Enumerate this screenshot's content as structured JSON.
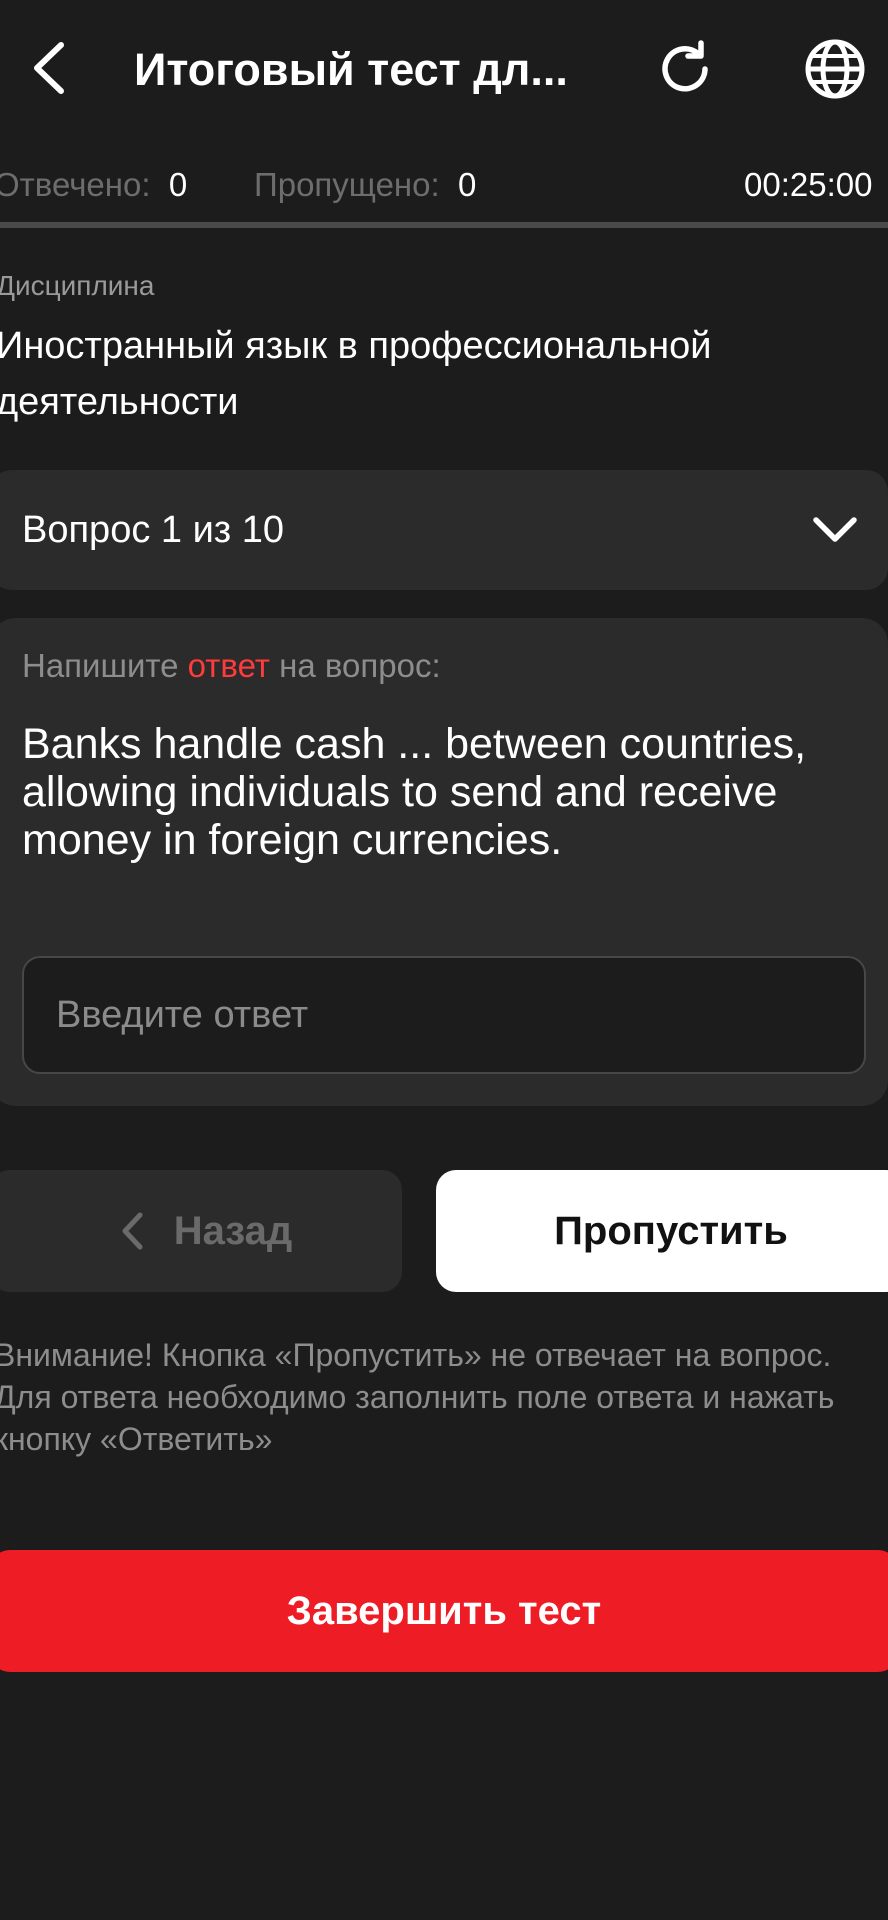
{
  "header": {
    "title": "Итоговый тест дл...",
    "back_icon": "chevron-left-icon",
    "refresh_icon": "refresh-icon",
    "globe_icon": "globe-icon"
  },
  "stats": {
    "answered_label": "Отвечено:",
    "answered_value": "0",
    "skipped_label": "Пропущено:",
    "skipped_value": "0",
    "timer": "00:25:00"
  },
  "discipline": {
    "label": "Дисциплина",
    "value": "Иностранный язык в профессиональной деятельности"
  },
  "question_selector": {
    "label": "Вопрос 1 из 10"
  },
  "question": {
    "instruction_prefix": "Напишите ",
    "instruction_accent": "ответ",
    "instruction_suffix": " на вопрос:",
    "text": "Banks handle cash ... between countries, allowing individuals to send and receive money in foreign currencies.",
    "answer_value": "",
    "answer_placeholder": "Введите ответ"
  },
  "buttons": {
    "back_label": "Назад",
    "skip_label": "Пропустить",
    "finish_label": "Завершить тест"
  },
  "warning": "Внимание! Кнопка «Пропустить» не отвечает на вопрос. Для ответа необходимо заполнить поле ответа и нажать кнопку «Ответить»",
  "colors": {
    "background": "#1c1c1c",
    "card": "#2b2b2b",
    "accent_red": "#ee1c25",
    "accent_text_red": "#ff3b3b"
  }
}
